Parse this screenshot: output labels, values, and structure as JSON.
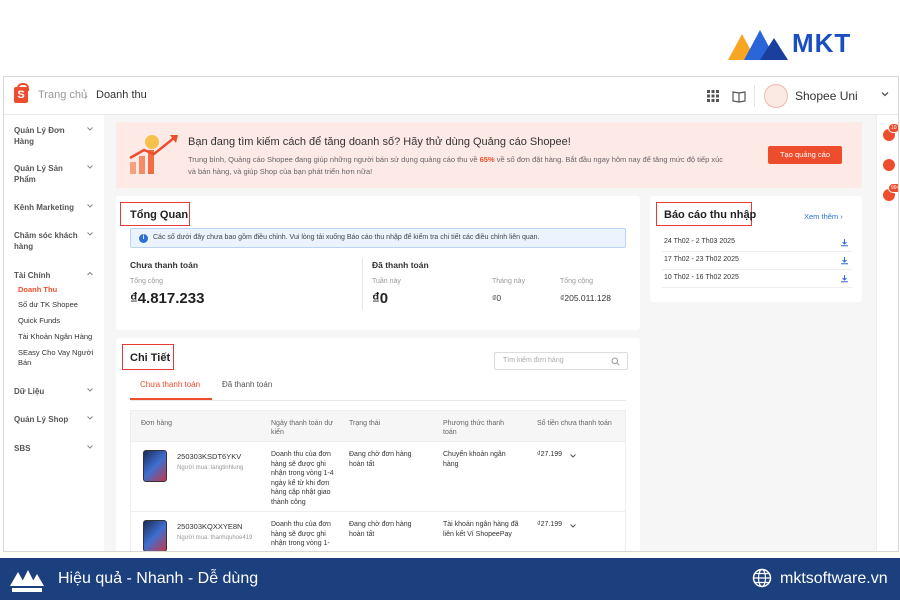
{
  "brand": {
    "name": "MKT"
  },
  "topbar": {
    "breadcrumb_home": "Trang chủ",
    "breadcrumb_sep": "›",
    "breadcrumb_current": "Doanh thu",
    "shop_name": "Shopee Uni"
  },
  "sidebar": {
    "items": [
      {
        "label": "Quản Lý Đơn Hàng"
      },
      {
        "label": "Quản Lý Sản Phẩm"
      },
      {
        "label": "Kênh Marketing"
      },
      {
        "label": "Chăm sóc khách hàng"
      },
      {
        "label": "Tài Chính"
      },
      {
        "label": "Dữ Liệu"
      },
      {
        "label": "Quản Lý Shop"
      },
      {
        "label": "SBS"
      }
    ],
    "finance_sub": [
      {
        "label": "Doanh Thu"
      },
      {
        "label": "Số dư TK Shopee"
      },
      {
        "label": "Quick Funds"
      },
      {
        "label": "Tài Khoản Ngân Hàng"
      },
      {
        "label": "SEasy Cho Vay Người Bán"
      }
    ]
  },
  "rail": {
    "badge1": "10",
    "badge2": "99+"
  },
  "banner": {
    "title": "Bạn đang tìm kiếm cách để tăng doanh số? Hãy thử dùng Quảng cáo Shopee!",
    "desc_before": "Trung bình, Quảng cáo Shopee đang giúp những người bán sử dụng quảng cáo thu về ",
    "desc_highlight": "65%",
    "desc_after": " về số đơn đặt hàng. Bắt đầu ngay hôm nay để tăng mức độ tiếp xúc và bán hàng, và giúp Shop của bạn phát triển hơn nữa!",
    "button": "Tạo quảng cáo"
  },
  "overview": {
    "title": "Tổng Quan",
    "info_icon": "i",
    "info": "Các số dưới đây chưa bao gồm điều chỉnh. Vui lòng tải xuống Báo cáo thu nhập để kiểm tra chi tiết các điều chỉnh liên quan.",
    "unpaid_label": "Chưa thanh toán",
    "unpaid_total_label": "Tổng cộng",
    "unpaid_total": "₫4.817.233",
    "paid_label": "Đã thanh toán",
    "week_label": "Tuần này",
    "week_value": "₫0",
    "month_label": "Tháng này",
    "month_value": "₫0",
    "paid_total_label": "Tổng cộng",
    "paid_total": "₫205.011.128"
  },
  "report": {
    "title": "Báo cáo thu nhập",
    "more": "Xem thêm ›",
    "rows": [
      {
        "label": "24 Th02 - 2 Th03 2025"
      },
      {
        "label": "17 Th02 - 23 Th02 2025"
      },
      {
        "label": "10 Th02 - 16 Th02 2025"
      }
    ]
  },
  "detail": {
    "title": "Chi Tiết",
    "search_placeholder": "Tìm kiếm đơn hàng",
    "tabs": [
      {
        "label": "Chưa thanh toán"
      },
      {
        "label": "Đã thanh toán"
      }
    ],
    "columns": [
      {
        "label": "Đơn hàng"
      },
      {
        "label": "Ngày thanh toán dự kiến"
      },
      {
        "label": "Trạng thái"
      },
      {
        "label": "Phương thức thanh toán"
      },
      {
        "label": "Số tiền chưa thanh toán"
      }
    ],
    "rows": [
      {
        "order_id": "250303KSDT6YKV",
        "buyer": "Người mua: tangtinhlung",
        "date": "Doanh thu của đơn hàng sẽ được ghi nhận trong vòng 1-4 ngày kể từ khi đơn hàng cập nhật giao thành công",
        "status": "Đang chờ đơn hàng hoàn tất",
        "method": "Chuyển khoản ngân hàng",
        "amount": "₫27.199"
      },
      {
        "order_id": "250303KQXXYE8N",
        "buyer": "Người mua: thanhquhoe419",
        "date": "Doanh thu của đơn hàng sẽ được ghi nhận trong vòng 1-",
        "status": "Đang chờ đơn hàng hoàn tất",
        "method": "Tài khoản ngân hàng đã liên kết Ví ShopeePay",
        "amount": "₫27.199"
      }
    ]
  },
  "footer": {
    "tagline": "Hiệu quả - Nhanh - Dễ dùng",
    "website": "mktsoftware.vn"
  },
  "colors": {
    "accent": "#ee4d2d",
    "link": "#2d6fd6",
    "footer": "#1c3f7e",
    "highlight_box": "#e53935"
  }
}
